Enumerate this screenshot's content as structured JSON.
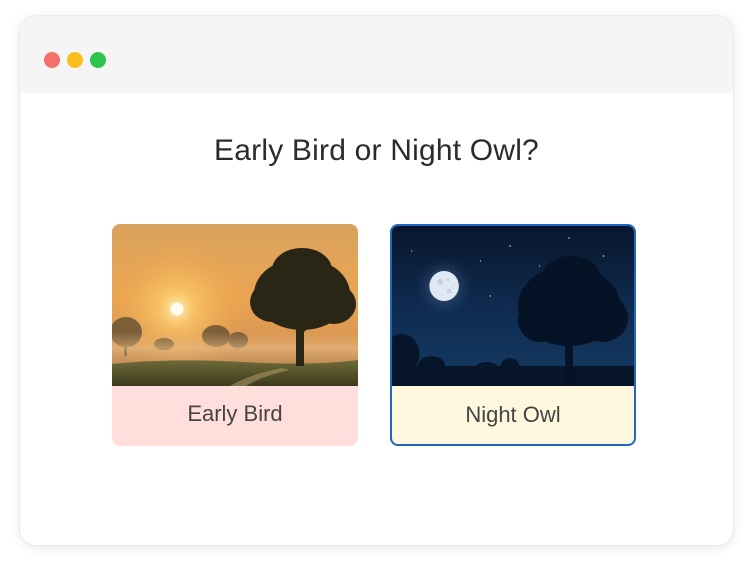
{
  "window": {
    "controls": [
      "close",
      "minimize",
      "maximize"
    ],
    "colors": {
      "close": "#f47068",
      "minimize": "#f8be1d",
      "maximize": "#2ec44d"
    }
  },
  "quiz": {
    "question": "Early Bird or Night Owl?",
    "options": [
      {
        "label": "Early Bird",
        "image": "sunrise-meadow-tree",
        "background": "#ffdedc",
        "selected": false
      },
      {
        "label": "Night Owl",
        "image": "moonlit-night-tree",
        "background": "#fff8df",
        "selected": true
      }
    ],
    "selected_border_color": "#1f67c0"
  }
}
